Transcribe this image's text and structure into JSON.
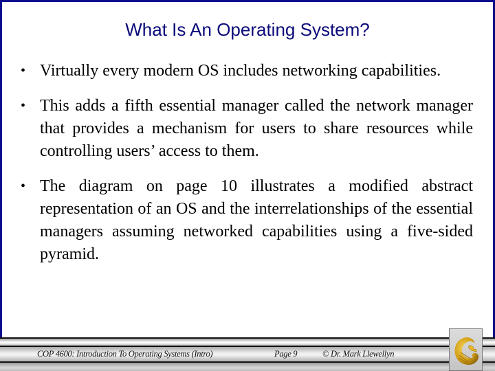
{
  "slide": {
    "title": "What Is An Operating System?",
    "bullets": [
      {
        "marker": "•",
        "text": "Virtually every modern OS includes networking capabilities."
      },
      {
        "marker": "•",
        "text": "This adds a fifth essential manager called the network manager that provides a mechanism for users to share resources while controlling users’ access to them."
      },
      {
        "marker": "•",
        "text": "The diagram on page 10 illustrates a modified abstract representation of an OS and the interrelationships of the essential managers assuming networked capabilities using a five-sided pyramid."
      }
    ]
  },
  "footer": {
    "course": "COP 4600: Introduction To Operating Systems (Intro)",
    "page": "Page 9",
    "author": "© Dr. Mark Llewellyn",
    "logo_icon": "pegasus-logo-icon"
  },
  "colors": {
    "title": "#0a0a7a",
    "frame_border": "#0a0a8c",
    "logo_gold": "#d4a017"
  }
}
